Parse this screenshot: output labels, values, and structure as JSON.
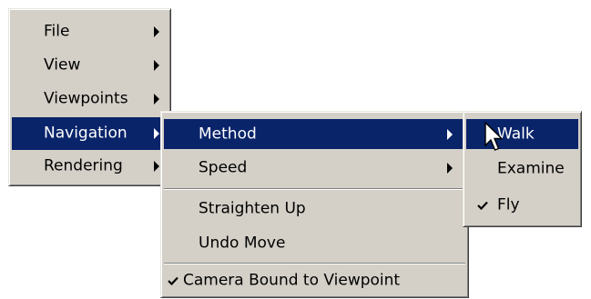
{
  "main_menu": {
    "items": [
      {
        "label": "File",
        "submenu_icon": "triangle-right-icon"
      },
      {
        "label": "View",
        "submenu_icon": "triangle-right-icon"
      },
      {
        "label": "Viewpoints",
        "submenu_icon": "triangle-right-icon"
      },
      {
        "label": "Navigation",
        "submenu_icon": "triangle-right-icon",
        "highlighted": true
      },
      {
        "label": "Rendering",
        "submenu_icon": "triangle-right-icon"
      }
    ]
  },
  "navigation_menu": {
    "items": [
      {
        "label": "Method",
        "submenu_icon": "triangle-right-icon",
        "highlighted": true
      },
      {
        "label": "Speed",
        "submenu_icon": "triangle-right-icon"
      },
      {
        "label": "Straighten Up"
      },
      {
        "label": "Undo Move"
      },
      {
        "label": "Camera Bound to Viewpoint",
        "checked": true,
        "check_icon": "checkmark-icon"
      }
    ]
  },
  "method_menu": {
    "items": [
      {
        "label": "Walk",
        "highlighted": true
      },
      {
        "label": "Examine"
      },
      {
        "label": "Fly",
        "checked": true,
        "check_icon": "checkmark-icon"
      }
    ]
  },
  "cursor": {
    "icon": "mouse-pointer-icon"
  },
  "colors": {
    "menu_background": "#d4d0c8",
    "highlight": "#0a246a",
    "highlight_text": "#ffffff",
    "text": "#000000"
  }
}
